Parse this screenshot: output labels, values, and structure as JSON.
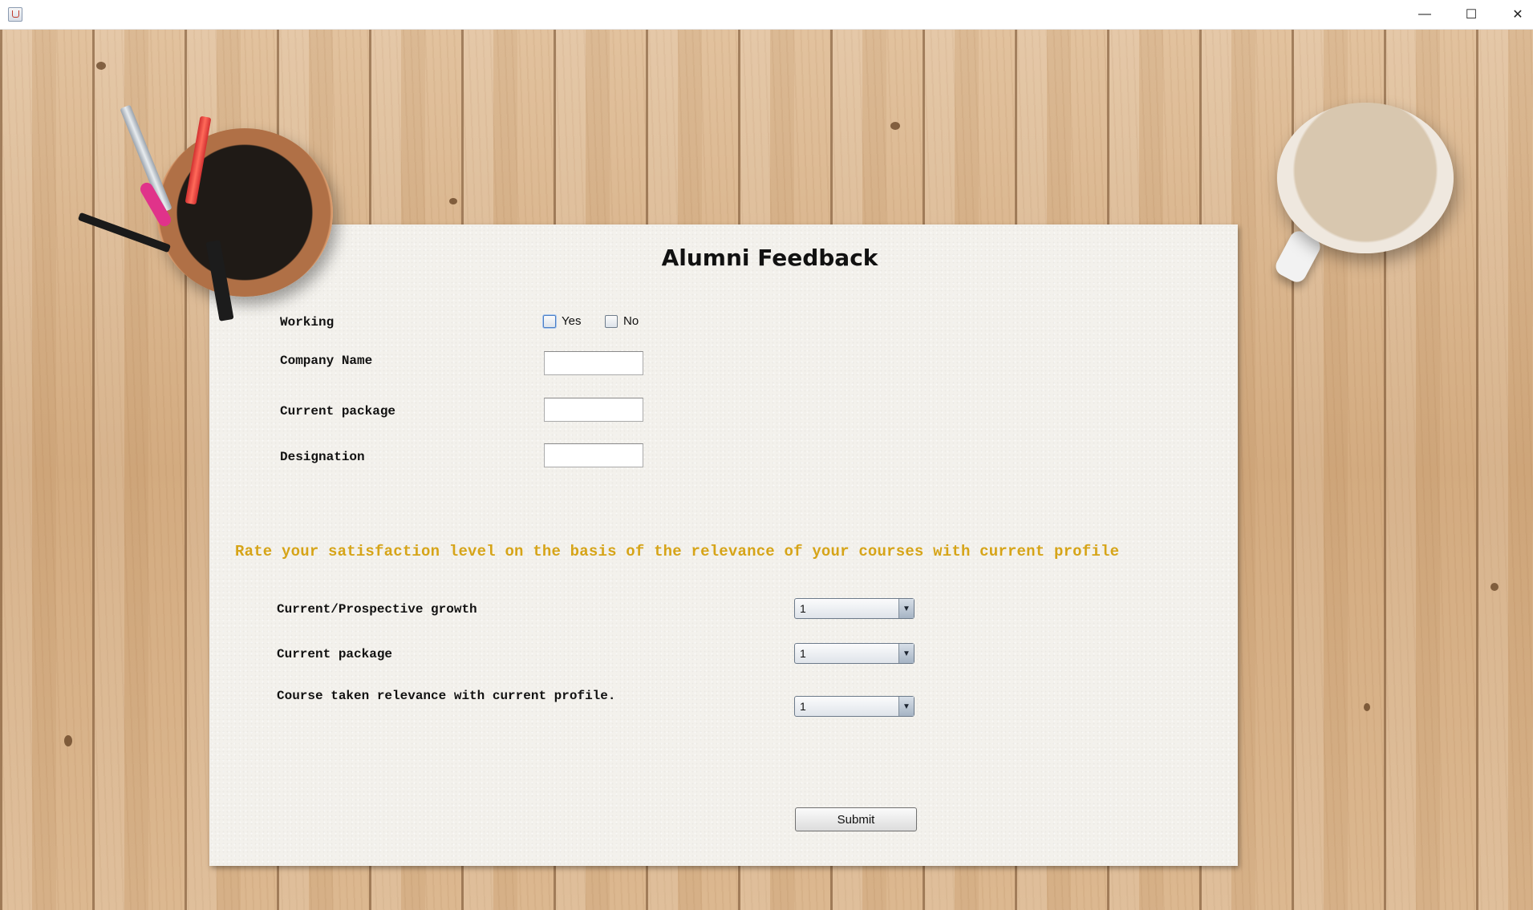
{
  "window": {
    "minimize_icon": "minimize-icon",
    "maximize_icon": "maximize-icon",
    "close_icon": "close-icon",
    "minimize_glyph": "—",
    "maximize_glyph": "☐",
    "close_glyph": "✕"
  },
  "form": {
    "title": "Alumni Feedback",
    "working": {
      "label": "Working",
      "options": [
        {
          "label": "Yes",
          "checked": false
        },
        {
          "label": "No",
          "checked": false
        }
      ]
    },
    "fields": [
      {
        "label": "Company Name",
        "value": ""
      },
      {
        "label": "Current package",
        "value": ""
      },
      {
        "label": "Designation",
        "value": ""
      }
    ],
    "question": "Rate your satisfaction level on the basis of the relevance of your courses with current profile",
    "ratings": [
      {
        "label": "Current/Prospective growth",
        "value": "1"
      },
      {
        "label": "Current package",
        "value": "1"
      },
      {
        "label": "Course taken relevance with current profile.",
        "value": "1"
      }
    ],
    "submit_label": "Submit",
    "question_color": "#d6a418"
  }
}
